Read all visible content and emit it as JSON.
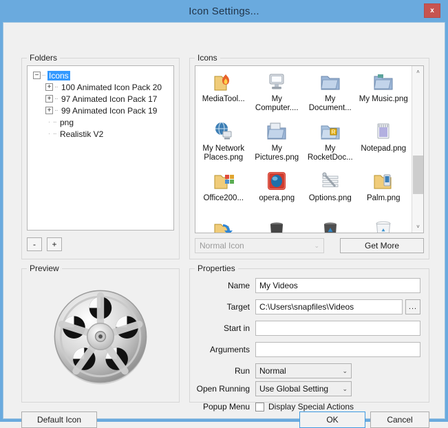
{
  "window": {
    "title": "Icon Settings...",
    "close_label": "x",
    "accent_color": "#6aaade",
    "close_color": "#c75450"
  },
  "folders": {
    "legend": "Folders",
    "tree": [
      {
        "label": "Icons",
        "expander": "minus",
        "selected": true,
        "depth": 0
      },
      {
        "label": "100 Animated Icon Pack  20",
        "expander": "plus",
        "selected": false,
        "depth": 1
      },
      {
        "label": "97 Animated Icon Pack  17",
        "expander": "plus",
        "selected": false,
        "depth": 1
      },
      {
        "label": "99 Animated Icon Pack  19",
        "expander": "plus",
        "selected": false,
        "depth": 1
      },
      {
        "label": "png",
        "expander": "none",
        "selected": false,
        "depth": 1
      },
      {
        "label": "Realistik V2",
        "expander": "none",
        "selected": false,
        "depth": 1
      }
    ],
    "remove_button": "-",
    "add_button": "+"
  },
  "icons": {
    "legend": "Icons",
    "items": [
      {
        "caption": "MediaTool...",
        "icon": "media-folder-flame-icon"
      },
      {
        "caption": "My Computer....",
        "icon": "my-computer-icon"
      },
      {
        "caption": "My Document...",
        "icon": "documents-folder-icon"
      },
      {
        "caption": "My Music.png",
        "icon": "music-folder-icon"
      },
      {
        "caption": "My Network Places.png",
        "icon": "network-places-icon"
      },
      {
        "caption": "My Pictures.png",
        "icon": "pictures-folder-icon"
      },
      {
        "caption": "My RocketDoc...",
        "icon": "rocketdock-folder-icon"
      },
      {
        "caption": "Notepad.png",
        "icon": "notepad-icon"
      },
      {
        "caption": "Office200...",
        "icon": "office-folder-icon"
      },
      {
        "caption": "opera.png",
        "icon": "opera-icon"
      },
      {
        "caption": "Options.png",
        "icon": "options-sliders-icon"
      },
      {
        "caption": "Palm.png",
        "icon": "palm-folder-icon"
      },
      {
        "caption": "",
        "icon": "refresh-folder-icon"
      },
      {
        "caption": "",
        "icon": "trash-dark-icon"
      },
      {
        "caption": "",
        "icon": "recycle-bin-full-icon"
      },
      {
        "caption": "",
        "icon": "recycle-bin-empty-icon"
      }
    ],
    "scrollbar": {
      "up_arrow": "˄",
      "down_arrow": "˅"
    },
    "icon_type_value": "Normal Icon",
    "icon_type_chevron": "⌄",
    "get_more_label": "Get More"
  },
  "preview": {
    "legend": "Preview",
    "icon_name": "film-reel-icon"
  },
  "properties": {
    "legend": "Properties",
    "fields": [
      {
        "label": "Name",
        "value": "My Videos",
        "placeholder": "",
        "type": "text"
      },
      {
        "label": "Target",
        "value": "C:\\Users\\snapfiles\\Videos",
        "placeholder": "",
        "type": "text-browse",
        "browse_label": "..."
      },
      {
        "label": "Start in",
        "value": "",
        "placeholder": "",
        "type": "text"
      },
      {
        "label": "Arguments",
        "value": "",
        "placeholder": "",
        "type": "text"
      },
      {
        "label": "Run",
        "value": "Normal",
        "type": "select"
      },
      {
        "label": "Open Running",
        "value": "Use Global Setting",
        "type": "select"
      },
      {
        "label": "Popup Menu",
        "value": "Display Special Actions",
        "type": "checkbox",
        "checked": false
      }
    ],
    "chevron": "⌄"
  },
  "footer": {
    "default_icon_label": "Default Icon",
    "ok_label": "OK",
    "cancel_label": "Cancel"
  }
}
